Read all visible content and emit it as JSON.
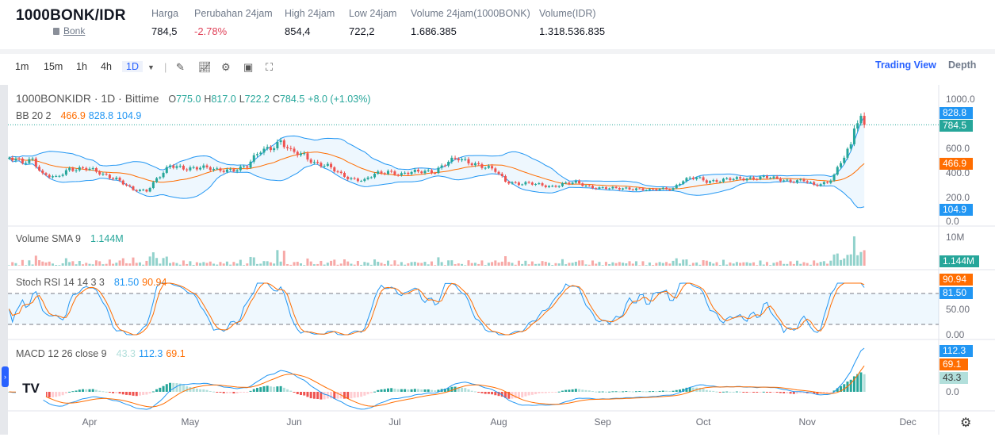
{
  "header": {
    "pair": "1000BONK/IDR",
    "coin_name": "Bonk",
    "stats": [
      {
        "label": "Harga",
        "value": "784,5"
      },
      {
        "label": "Perubahan 24jam",
        "value": "-2.78%"
      },
      {
        "label": "High 24jam",
        "value": "854,4"
      },
      {
        "label": "Low 24jam",
        "value": "722,2"
      },
      {
        "label": "Volume 24jam(1000BONK)",
        "value": "1.686.385"
      },
      {
        "label": "Volume(IDR)",
        "value": "1.318.536.835"
      }
    ]
  },
  "toolbar": {
    "timeframes": [
      "1m",
      "15m",
      "1h",
      "4h",
      "1D"
    ],
    "selected": "1D",
    "icons": [
      "draw-icon",
      "indicator-icon",
      "settings-icon",
      "save-icon",
      "fullscreen-icon"
    ],
    "view_tabs": {
      "trading_view": "Trading View",
      "depth": "Depth"
    }
  },
  "colors": {
    "up": "#26a69a",
    "down": "#ef5350",
    "bb_basis": "#ff6d00",
    "bb_band": "#2196f3",
    "accent": "#2962ff",
    "stoch_k": "#2196f3",
    "stoch_d": "#ff6d00"
  },
  "legend": {
    "symbol": "1000BONKIDR · 1D · Bittime",
    "ohlc": {
      "o_label": "O",
      "o": "775.0",
      "h_label": "H",
      "h": "817.0",
      "l_label": "L",
      "l": "722.2",
      "c_label": "C",
      "c": "784.5",
      "change": "+8.0 (+1.03%)"
    },
    "bb": {
      "name": "BB 20 2",
      "basis": "466.9",
      "upper": "828.8",
      "lower": "104.9"
    },
    "volume": {
      "name": "Volume SMA 9",
      "value": "1.144M"
    },
    "stoch": {
      "name": "Stoch RSI 14 14 3 3",
      "k": "81.50",
      "d": "90.94"
    },
    "macd": {
      "name": "MACD 12 26 close 9",
      "hist": "43.3",
      "macd": "112.3",
      "signal": "69.1"
    }
  },
  "price_axis": {
    "ticks": [
      "1000.0",
      "600.0",
      "400.0",
      "200.0",
      "0.0"
    ],
    "badges": {
      "upper": "828.8",
      "last": "784.5",
      "basis": "466.9",
      "lower": "104.9"
    }
  },
  "volume_axis": {
    "ticks": [
      "10M"
    ],
    "badge": "1.144M"
  },
  "stoch_axis": {
    "ticks": [
      "50.00",
      "0.00"
    ],
    "badges": {
      "d": "90.94",
      "k": "81.50"
    }
  },
  "macd_axis": {
    "ticks": [
      "0.0"
    ],
    "badges": {
      "macd": "112.3",
      "signal": "69.1",
      "hist": "43.3"
    }
  },
  "time_axis": [
    "Apr",
    "May",
    "Jun",
    "Jul",
    "Aug",
    "Sep",
    "Oct",
    "Nov",
    "Dec"
  ],
  "chart_data": {
    "type": "candlestick",
    "title": "1000BONKIDR · 1D · Bittime",
    "ylim": [
      0,
      1000
    ],
    "grid": false,
    "x": [
      "03-08",
      "03-12",
      "03-15",
      "03-18",
      "03-22",
      "03-26",
      "03-31",
      "04-05",
      "04-09",
      "04-14",
      "04-18",
      "04-21",
      "04-25",
      "04-29",
      "05-04",
      "05-09",
      "05-14",
      "05-18",
      "05-22",
      "05-25",
      "05-28",
      "05-31",
      "06-04",
      "06-07",
      "06-11",
      "06-15",
      "06-18",
      "06-22",
      "06-25",
      "06-29",
      "07-03",
      "07-06",
      "07-10",
      "07-13",
      "07-17",
      "07-20",
      "07-24",
      "07-27",
      "07-31",
      "08-03",
      "08-07",
      "08-10",
      "08-14",
      "08-17",
      "08-21",
      "08-24",
      "08-28",
      "08-31",
      "09-04",
      "09-08",
      "09-11",
      "09-15",
      "09-18",
      "09-22",
      "09-25",
      "09-29",
      "10-02",
      "10-06",
      "10-09",
      "10-13",
      "10-17",
      "10-20",
      "10-24",
      "10-27",
      "10-31",
      "11-03",
      "11-07",
      "11-09",
      "11-11",
      "11-14",
      "11-15",
      "11-17",
      "11-18"
    ],
    "close": [
      510,
      480,
      510,
      380,
      350,
      430,
      430,
      380,
      350,
      250,
      250,
      350,
      445,
      430,
      445,
      410,
      425,
      445,
      575,
      605,
      650,
      560,
      540,
      480,
      445,
      380,
      350,
      330,
      380,
      410,
      380,
      395,
      410,
      410,
      480,
      510,
      480,
      445,
      410,
      330,
      305,
      305,
      295,
      285,
      305,
      315,
      285,
      270,
      265,
      270,
      265,
      250,
      265,
      270,
      330,
      355,
      330,
      330,
      340,
      350,
      355,
      355,
      340,
      330,
      330,
      290,
      320,
      380,
      480,
      605,
      770,
      835,
      784.5
    ]
  }
}
